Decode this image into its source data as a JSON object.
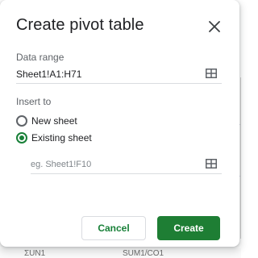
{
  "dialog": {
    "title": "Create pivot table",
    "close_icon": "close-icon",
    "data_range": {
      "label": "Data range",
      "value": "Sheet1!A1:H71",
      "icon": "grid-select-icon"
    },
    "insert_to": {
      "label": "Insert to",
      "options": [
        {
          "label": "New sheet",
          "selected": false
        },
        {
          "label": "Existing sheet",
          "selected": true
        }
      ],
      "location_placeholder": "eg. Sheet1!F10",
      "icon": "grid-select-icon"
    },
    "buttons": {
      "cancel": "Cancel",
      "create": "Create"
    }
  },
  "background": {
    "bottom_fragment_1": "ΣUN1",
    "bottom_fragment_2": "SUM1/CO1"
  },
  "colors": {
    "accent": "#188038",
    "create_button": "#1e7e34",
    "text_primary": "#202124",
    "text_secondary": "#5f6368"
  }
}
